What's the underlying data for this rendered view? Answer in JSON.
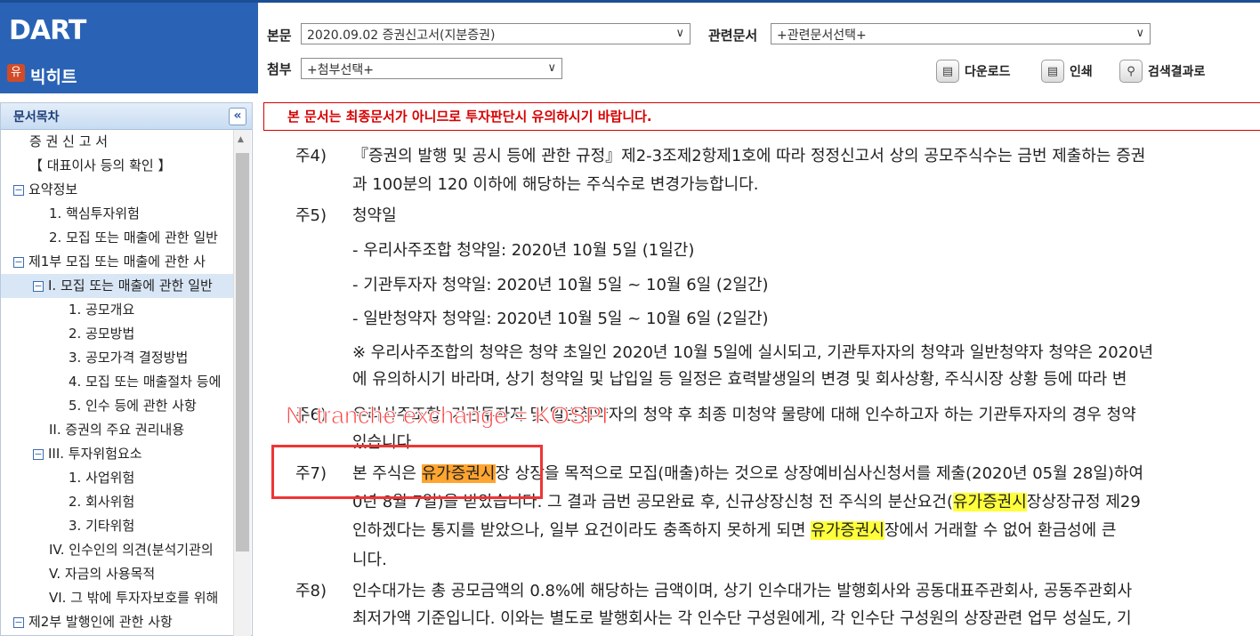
{
  "header": {
    "logo_text": "DART",
    "company_name": "빅히트",
    "company_icon": "유",
    "main_doc_label": "본문",
    "main_doc_value": "2020.09.02  증권신고서(지분증권)",
    "related_label": "관련문서",
    "related_value": "+관련문서선택+",
    "attach_label": "첨부",
    "attach_value": "+첨부선택+",
    "download_label": "다운로드",
    "print_label": "인쇄",
    "search_label": "검색결과로"
  },
  "sidebar": {
    "title": "문서목차",
    "items": [
      {
        "label": "증 권 신 고 서"
      },
      {
        "label": "【 대표이사 등의 확인 】"
      },
      {
        "label": "요약정보"
      },
      {
        "label": "1. 핵심투자위험"
      },
      {
        "label": "2. 모집 또는 매출에 관한 일반"
      },
      {
        "label": "제1부 모집 또는 매출에 관한 사"
      },
      {
        "label": "I. 모집 또는 매출에 관한 일반"
      },
      {
        "label": "1. 공모개요"
      },
      {
        "label": "2. 공모방법"
      },
      {
        "label": "3. 공모가격 결정방법"
      },
      {
        "label": "4. 모집 또는 매출절차 등에"
      },
      {
        "label": "5. 인수 등에 관한 사항"
      },
      {
        "label": "II. 증권의 주요 권리내용"
      },
      {
        "label": "III. 투자위험요소"
      },
      {
        "label": "1. 사업위험"
      },
      {
        "label": "2. 회사위험"
      },
      {
        "label": "3. 기타위험"
      },
      {
        "label": "IV. 인수인의 의견(분석기관의"
      },
      {
        "label": "V. 자금의 사용목적"
      },
      {
        "label": "VI. 그 밖에 투자자보호를 위해"
      },
      {
        "label": "제2부 발행인에 관한 사항"
      }
    ]
  },
  "content": {
    "warning": "본 문서는 최종문서가 아니므로 투자판단시 유의하시기 바랍니다.",
    "n4_label": "주4)",
    "n4_l1": "『증권의 발행 및 공시 등에 관한 규정』제2-3조제2항제1호에 따라 정정신고서 상의 공모주식수는 금번 제출하는 증권",
    "n4_l2": "과 100분의 120 이하에 해당하는 주식수로 변경가능합니다.",
    "n5_label": "주5)",
    "n5_title": "청약일",
    "n5_l1": "- 우리사주조합 청약일: 2020년 10월 5일 (1일간)",
    "n5_l2": "- 기관투자자 청약일: 2020년 10월 5일 ~ 10월 6일 (2일간)",
    "n5_l3": "- 일반청약자 청약일: 2020년 10월 5일 ~ 10월 6일 (2일간)",
    "n5_note1": "※ 우리사주조합의 청약은 청약 초일인 2020년 10월 5일에 실시되고, 기관투자자의 청약과 일반청약자 청약은 2020년",
    "n5_note2": "에 유의하시기 바라며, 상기 청약일 및 납입일 등 일정은 효력발생일의 변경 및 회사상황, 주식시장 상황 등에 따라 변",
    "n6_label": "주6)",
    "n6_l1": "우리사주조합, 기관투자자 및 일반청약자의 청약 후 최종 미청약 물량에 대해 인수하고자 하는 기관투자자의 경우 청약",
    "n6_l2": "있습니다.",
    "n7_label": "주7)",
    "n7_a": "본 주식은 ",
    "n7_hl1": "유가증권시",
    "n7_b": "장 상장을 목적으로 모집(매출)하는 것으로 상장예비심사신청서를 제출(2020년 05월 28일)하여",
    "n7_c": "0년 8월 7일)을 받았습니다. 그 결과 금번 공모완료 후, 신규상장신청 전 주식의 분산요건(",
    "n7_hl2": "유가증권시",
    "n7_d": "장상장규정 제29",
    "n7_e": "인하겠다는 통지를 받았으나, 일부 요건이라도 충족하지 못하게 되면 ",
    "n7_hl3": "유가증권시",
    "n7_f": "장에서 거래할 수 없어 환금성에 큰",
    "n7_g": "니다.",
    "n8_label": "주8)",
    "n8_l1": "인수대가는 총 공모금액의 0.8%에 해당하는 금액이며, 상기 인수대가는 발행회사와 공동대표주관회사, 공동주관회사",
    "n8_l2": "최저가액 기준입니다. 이와는 별도로 발행회사는 각 인수단 구성원에게, 각 인수단 구성원의 상장관련 업무 성실도, 기"
  },
  "annotation": {
    "text": "N. tranche exchange = KOSPI",
    "color": "#ff3d3d"
  }
}
